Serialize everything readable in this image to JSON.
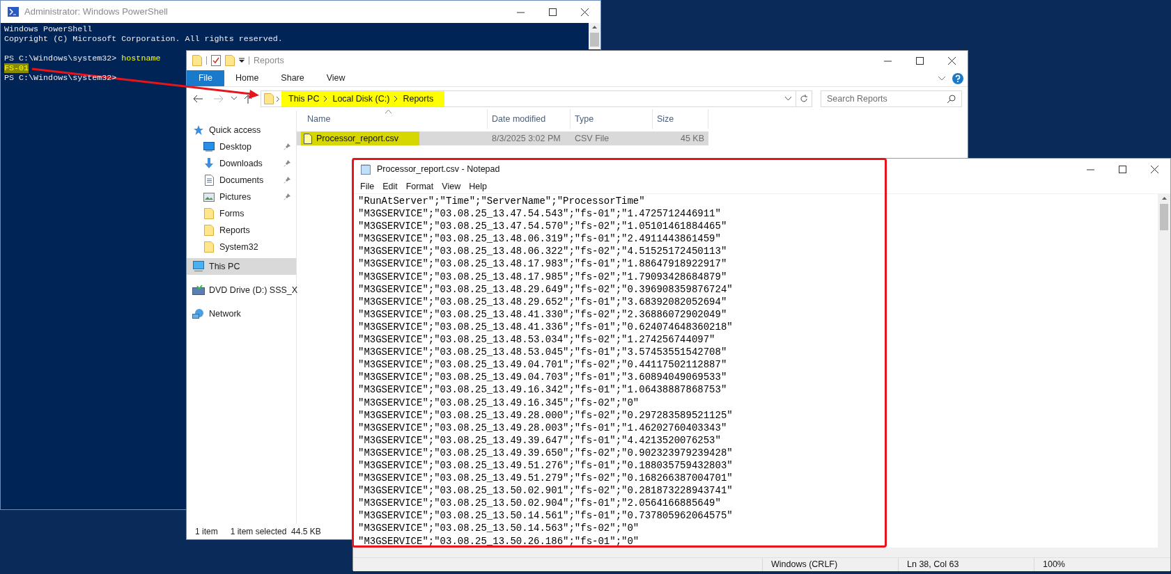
{
  "powershell": {
    "title": "Administrator: Windows PowerShell",
    "lines": [
      {
        "text": "Windows PowerShell",
        "kind": "output"
      },
      {
        "text": "Copyright (C) Microsoft Corporation. All rights reserved.",
        "kind": "output"
      },
      {
        "kind": "blank"
      },
      {
        "text": "PS C:\\Windows\\system32>",
        "command": "hostname",
        "kind": "prompt"
      },
      {
        "text": "FS-01",
        "kind": "result",
        "highlighted": true
      },
      {
        "text": "PS C:\\Windows\\system32>",
        "kind": "prompt"
      }
    ]
  },
  "explorer": {
    "title": "Reports",
    "ribbon_tabs": [
      {
        "label": "File",
        "selected": true
      },
      {
        "label": "Home",
        "selected": false
      },
      {
        "label": "Share",
        "selected": false
      },
      {
        "label": "View",
        "selected": false
      }
    ],
    "breadcrumb": {
      "items": [
        "This PC",
        "Local Disk (C:)",
        "Reports"
      ],
      "highlighted": true
    },
    "search": {
      "placeholder": "Search Reports"
    },
    "sidebar": {
      "items": [
        {
          "label": "Quick access",
          "selected": false,
          "children": [
            {
              "label": "Desktop",
              "pinned": true,
              "selected": false
            },
            {
              "label": "Downloads",
              "pinned": true,
              "selected": false
            },
            {
              "label": "Documents",
              "pinned": true,
              "selected": false
            },
            {
              "label": "Pictures",
              "pinned": true,
              "selected": false
            },
            {
              "label": "Forms",
              "pinned": false,
              "selected": false
            },
            {
              "label": "Reports",
              "pinned": false,
              "selected": false
            },
            {
              "label": "System32",
              "pinned": false,
              "selected": false
            }
          ]
        },
        {
          "label": "This PC",
          "selected": true
        },
        {
          "label": "DVD Drive (D:) SSS_X",
          "selected": false
        },
        {
          "label": "Network",
          "selected": false
        }
      ]
    },
    "table": {
      "columns": [
        "Name",
        "Date modified",
        "Type",
        "Size"
      ],
      "rows": [
        {
          "name": "Processor_report.csv",
          "date": "8/3/2025 3:02 PM",
          "type": "CSV File",
          "size": "45 KB",
          "selected": true,
          "highlighted": true
        }
      ]
    },
    "status_bar": [
      "1 item",
      "1 item selected  44.5 KB"
    ]
  },
  "notepad": {
    "title": "Processor_report.csv - Notepad",
    "menu": [
      "File",
      "Edit",
      "Format",
      "View",
      "Help"
    ],
    "lines": [
      "\"RunAtServer\";\"Time\";\"ServerName\";\"ProcessorTime\"",
      "\"M3GSERVICE\";\"03.08.25_13.47.54.543\";\"fs-01\";\"1.4725712446911\"",
      "\"M3GSERVICE\";\"03.08.25_13.47.54.570\";\"fs-02\";\"1.05101461884465\"",
      "\"M3GSERVICE\";\"03.08.25_13.48.06.319\";\"fs-01\";\"2.4911443861459\"",
      "\"M3GSERVICE\";\"03.08.25_13.48.06.322\";\"fs-02\";\"4.51525172450113\"",
      "\"M3GSERVICE\";\"03.08.25_13.48.17.983\";\"fs-01\";\"1.88647918922917\"",
      "\"M3GSERVICE\";\"03.08.25_13.48.17.985\";\"fs-02\";\"1.79093428684879\"",
      "\"M3GSERVICE\";\"03.08.25_13.48.29.649\";\"fs-02\";\"0.396908359876724\"",
      "\"M3GSERVICE\";\"03.08.25_13.48.29.652\";\"fs-01\";\"3.68392082052694\"",
      "\"M3GSERVICE\";\"03.08.25_13.48.41.330\";\"fs-02\";\"2.36886072902049\"",
      "\"M3GSERVICE\";\"03.08.25_13.48.41.336\";\"fs-01\";\"0.624074648360218\"",
      "\"M3GSERVICE\";\"03.08.25_13.48.53.034\";\"fs-02\";\"1.274256744097\"",
      "\"M3GSERVICE\";\"03.08.25_13.48.53.045\";\"fs-01\";\"3.57453551542708\"",
      "\"M3GSERVICE\";\"03.08.25_13.49.04.701\";\"fs-02\";\"0.44117502112887\"",
      "\"M3GSERVICE\";\"03.08.25_13.49.04.703\";\"fs-01\";\"3.60894049069533\"",
      "\"M3GSERVICE\";\"03.08.25_13.49.16.342\";\"fs-01\";\"1.06438887868753\"",
      "\"M3GSERVICE\";\"03.08.25_13.49.16.345\";\"fs-02\";\"0\"",
      "\"M3GSERVICE\";\"03.08.25_13.49.28.000\";\"fs-02\";\"0.297283589521125\"",
      "\"M3GSERVICE\";\"03.08.25_13.49.28.003\";\"fs-01\";\"1.46202760403343\"",
      "\"M3GSERVICE\";\"03.08.25_13.49.39.647\";\"fs-01\";\"4.4213520076253\"",
      "\"M3GSERVICE\";\"03.08.25_13.49.39.650\";\"fs-02\";\"0.902323979239428\"",
      "\"M3GSERVICE\";\"03.08.25_13.49.51.276\";\"fs-01\";\"0.188035759432803\"",
      "\"M3GSERVICE\";\"03.08.25_13.49.51.279\";\"fs-02\";\"0.168266387004701\"",
      "\"M3GSERVICE\";\"03.08.25_13.50.02.901\";\"fs-02\";\"0.281873228943741\"",
      "\"M3GSERVICE\";\"03.08.25_13.50.02.904\";\"fs-01\";\"2.0564166885649\"",
      "\"M3GSERVICE\";\"03.08.25_13.50.14.561\";\"fs-01\";\"0.737805962064575\"",
      "\"M3GSERVICE\";\"03.08.25_13.50.14.563\";\"fs-02\";\"0\"",
      "\"M3GSERVICE\";\"03.08.25_13.50.26.186\";\"fs-01\";\"0\""
    ],
    "status_bar": [
      "Windows (CRLF)",
      "Ln 38, Col 63",
      "100%"
    ]
  }
}
